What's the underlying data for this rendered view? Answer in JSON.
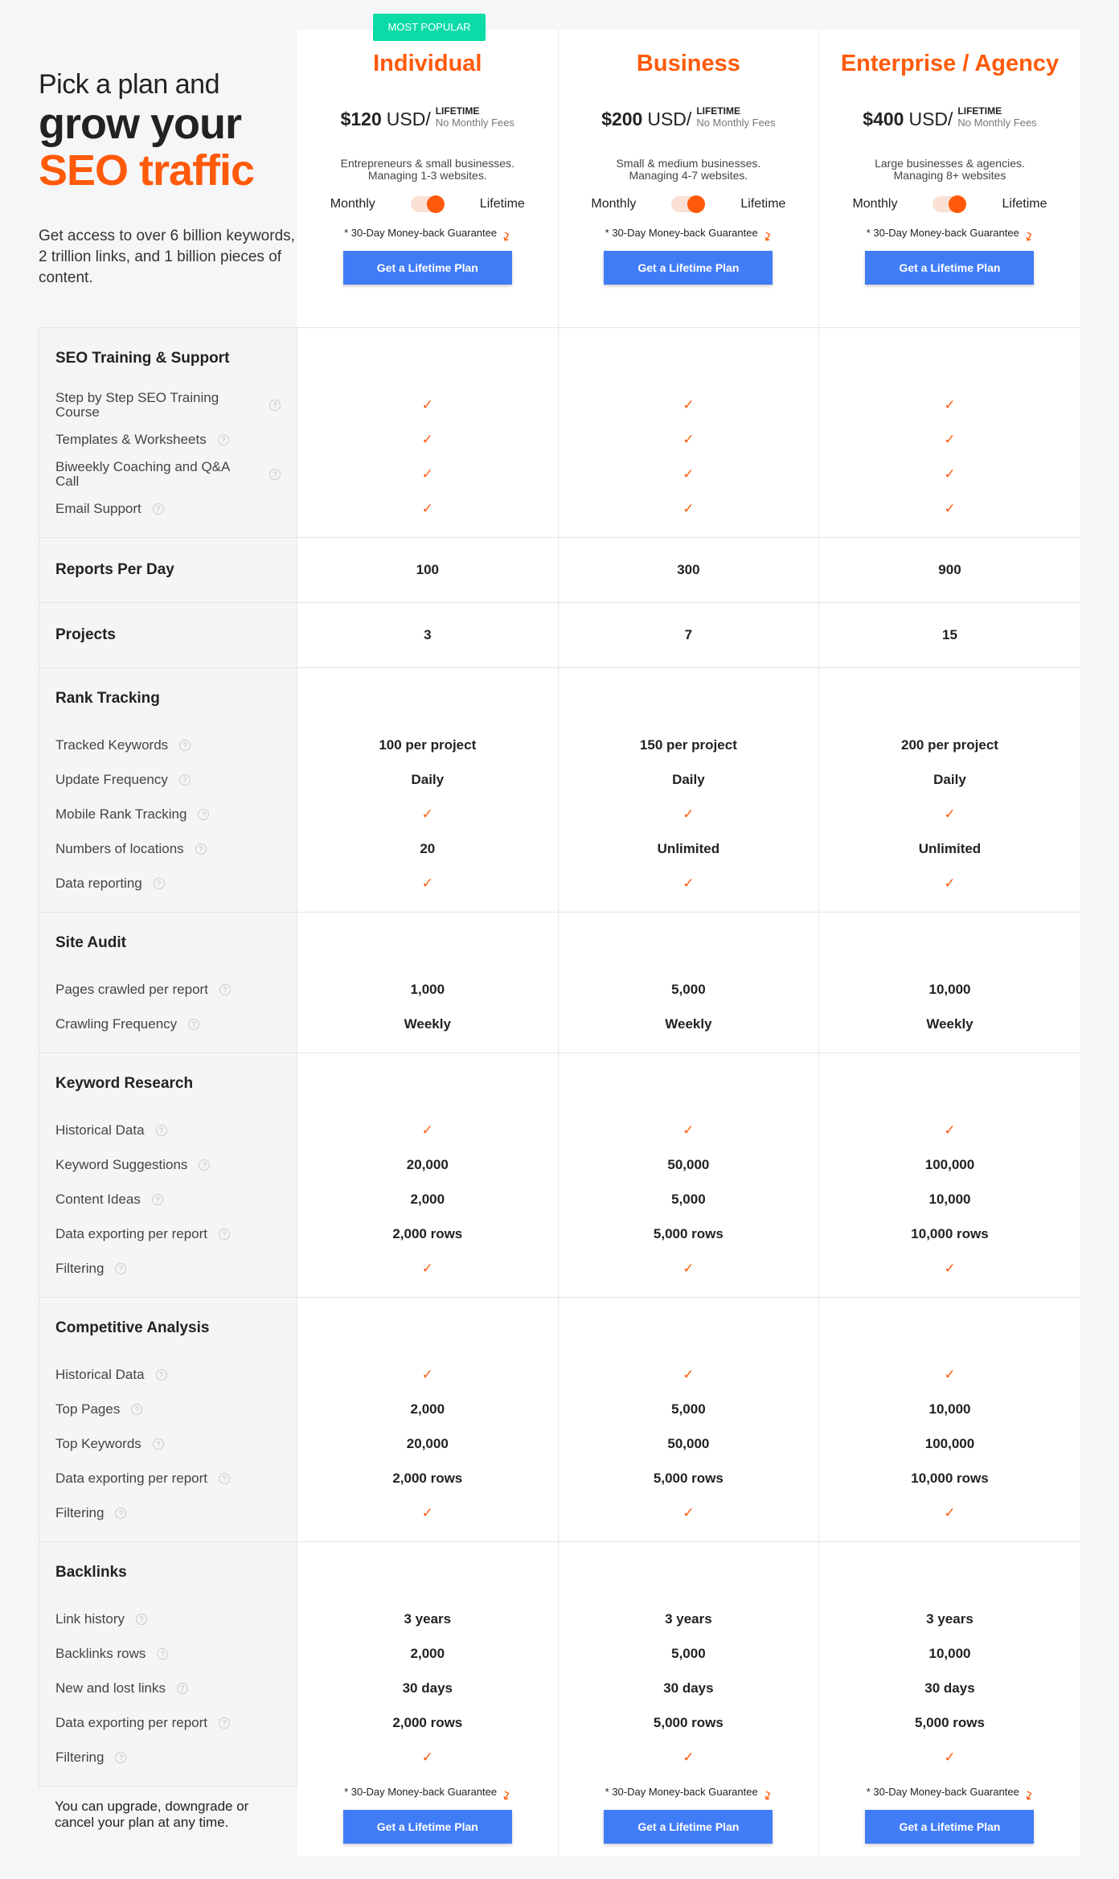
{
  "hero": {
    "line1": "Pick a plan and",
    "line2": "grow your",
    "line3": "SEO traffic",
    "sub": "Get access to over 6 billion keywords, 2 trillion links, and 1 billion pieces of content."
  },
  "badge": "MOST POPULAR",
  "colors": {
    "accent": "#ff5a0a",
    "button": "#417cf7",
    "badge": "#0bdba6"
  },
  "plans": [
    {
      "name": "Individual",
      "price": "$120",
      "unit": "USD/",
      "lifetime": "LIFETIME",
      "no_fees": "No Monthly Fees",
      "desc1": "Entrepreneurs & small businesses.",
      "desc2": "Managing 1-3 websites.",
      "monthly": "Monthly",
      "lifetime_label": "Lifetime",
      "guarantee": "* 30-Day Money-back Guarantee",
      "button": "Get a Lifetime Plan"
    },
    {
      "name": "Business",
      "price": "$200",
      "unit": "USD/",
      "lifetime": "LIFETIME",
      "no_fees": "No Monthly Fees",
      "desc1": "Small & medium businesses.",
      "desc2": "Managing 4-7 websites.",
      "monthly": "Monthly",
      "lifetime_label": "Lifetime",
      "guarantee": "* 30-Day Money-back Guarantee",
      "button": "Get a Lifetime Plan"
    },
    {
      "name": "Enterprise / Agency",
      "price": "$400",
      "unit": "USD/",
      "lifetime": "LIFETIME",
      "no_fees": "No Monthly Fees",
      "desc1": "Large businesses & agencies.",
      "desc2": "Managing 8+ websites",
      "monthly": "Monthly",
      "lifetime_label": "Lifetime",
      "guarantee": "* 30-Day Money-back Guarantee",
      "button": "Get a Lifetime Plan"
    }
  ],
  "toggle_state": "Lifetime",
  "sections": [
    {
      "title": "SEO Training & Support",
      "items": [
        {
          "label": "Step by Step SEO Training Course",
          "values": [
            "check",
            "check",
            "check"
          ]
        },
        {
          "label": "Templates & Worksheets",
          "values": [
            "check",
            "check",
            "check"
          ]
        },
        {
          "label": "Biweekly Coaching and Q&A Call",
          "values": [
            "check",
            "check",
            "check"
          ]
        },
        {
          "label": "Email Support",
          "values": [
            "check",
            "check",
            "check"
          ]
        }
      ]
    },
    {
      "title": "Reports Per Day",
      "values": [
        "100",
        "300",
        "900"
      ]
    },
    {
      "title": "Projects",
      "values": [
        "3",
        "7",
        "15"
      ]
    },
    {
      "title": "Rank Tracking",
      "items": [
        {
          "label": "Tracked Keywords",
          "values": [
            "100 per project",
            "150 per project",
            "200 per project"
          ]
        },
        {
          "label": "Update Frequency",
          "values": [
            "Daily",
            "Daily",
            "Daily"
          ]
        },
        {
          "label": "Mobile Rank Tracking",
          "values": [
            "check",
            "check",
            "check"
          ]
        },
        {
          "label": "Numbers of locations",
          "values": [
            "20",
            "Unlimited",
            "Unlimited"
          ]
        },
        {
          "label": "Data reporting",
          "values": [
            "check",
            "check",
            "check"
          ]
        }
      ]
    },
    {
      "title": "Site Audit",
      "items": [
        {
          "label": "Pages crawled per report",
          "values": [
            "1,000",
            "5,000",
            "10,000"
          ]
        },
        {
          "label": "Crawling Frequency",
          "values": [
            "Weekly",
            "Weekly",
            "Weekly"
          ]
        }
      ]
    },
    {
      "title": "Keyword Research",
      "items": [
        {
          "label": "Historical Data",
          "values": [
            "check",
            "check",
            "check"
          ]
        },
        {
          "label": "Keyword Suggestions",
          "values": [
            "20,000",
            "50,000",
            "100,000"
          ]
        },
        {
          "label": "Content Ideas",
          "values": [
            "2,000",
            "5,000",
            "10,000"
          ]
        },
        {
          "label": "Data exporting per report",
          "values": [
            "2,000 rows",
            "5,000 rows",
            "10,000 rows"
          ]
        },
        {
          "label": "Filtering",
          "values": [
            "check",
            "check",
            "check"
          ]
        }
      ]
    },
    {
      "title": "Competitive Analysis",
      "items": [
        {
          "label": "Historical Data",
          "values": [
            "check",
            "check",
            "check"
          ]
        },
        {
          "label": "Top Pages",
          "values": [
            "2,000",
            "5,000",
            "10,000"
          ]
        },
        {
          "label": "Top Keywords",
          "values": [
            "20,000",
            "50,000",
            "100,000"
          ]
        },
        {
          "label": "Data exporting per report",
          "values": [
            "2,000 rows",
            "5,000 rows",
            "10,000 rows"
          ]
        },
        {
          "label": "Filtering",
          "values": [
            "check",
            "check",
            "check"
          ]
        }
      ]
    },
    {
      "title": "Backlinks",
      "items": [
        {
          "label": "Link history",
          "values": [
            "3 years",
            "3 years",
            "3 years"
          ]
        },
        {
          "label": "Backlinks rows",
          "values": [
            "2,000",
            "5,000",
            "10,000"
          ]
        },
        {
          "label": "New and lost links",
          "values": [
            "30 days",
            "30 days",
            "30 days"
          ]
        },
        {
          "label": "Data exporting per report",
          "values": [
            "2,000 rows",
            "5,000 rows",
            "5,000 rows"
          ]
        },
        {
          "label": "Filtering",
          "values": [
            "check",
            "check",
            "check"
          ]
        }
      ]
    }
  ],
  "footer": {
    "text": "You can upgrade, downgrade or cancel your plan at any time."
  }
}
